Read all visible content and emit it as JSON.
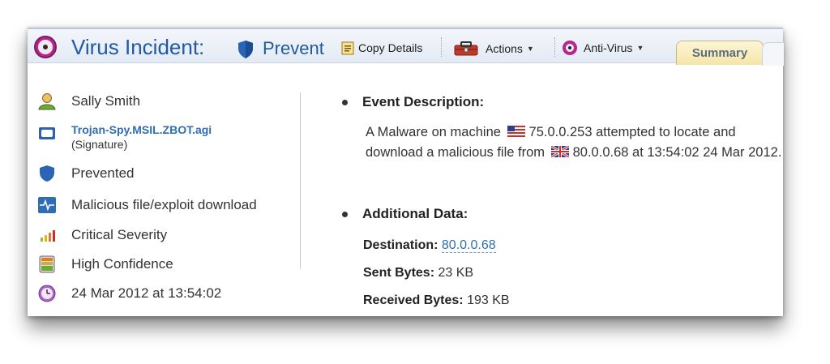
{
  "header": {
    "title": "Virus Incident:",
    "status_label": "Prevent",
    "copy_details_label": "Copy Details",
    "actions_label": "Actions",
    "antivirus_label": "Anti-Virus",
    "summary_tab_label": "Summary"
  },
  "details": {
    "user": "Sally Smith",
    "signature_name": "Trojan-Spy.MSIL.ZBOT.agi",
    "signature_suffix": "(Signature)",
    "action": "Prevented",
    "attack_type": "Malicious file/exploit download",
    "severity": "Critical Severity",
    "confidence": "High Confidence",
    "timestamp": "24 Mar 2012 at 13:54:02"
  },
  "event": {
    "title": "Event Description:",
    "text_1": "A Malware on machine",
    "source_ip": "75.0.0.253",
    "text_2": "attempted to locate and download a malicious file from",
    "dest_ip": "80.0.0.68",
    "text_3": "at 13:54:02 24 Mar 2012."
  },
  "additional": {
    "title": "Additional Data:",
    "destination_label": "Destination:",
    "destination_value": "80.0.0.68",
    "sent_label": "Sent Bytes:",
    "sent_value": "23 KB",
    "received_label": "Received Bytes:",
    "received_value": "193 KB"
  },
  "colors": {
    "title_blue": "#1f5aa3",
    "link_blue": "#2f6db5",
    "radiation_magenta": "#b3288a",
    "summary_tab": "#f4e6a8"
  },
  "icons": {
    "header": "radiation-icon",
    "shield": "shield-icon",
    "copy": "clipboard-icon",
    "actions": "toolbox-icon",
    "user": "user-icon",
    "signature": "signature-icon",
    "attack": "activity-icon",
    "severity": "severity-bars-icon",
    "confidence": "confidence-icon",
    "time": "clock-icon"
  }
}
